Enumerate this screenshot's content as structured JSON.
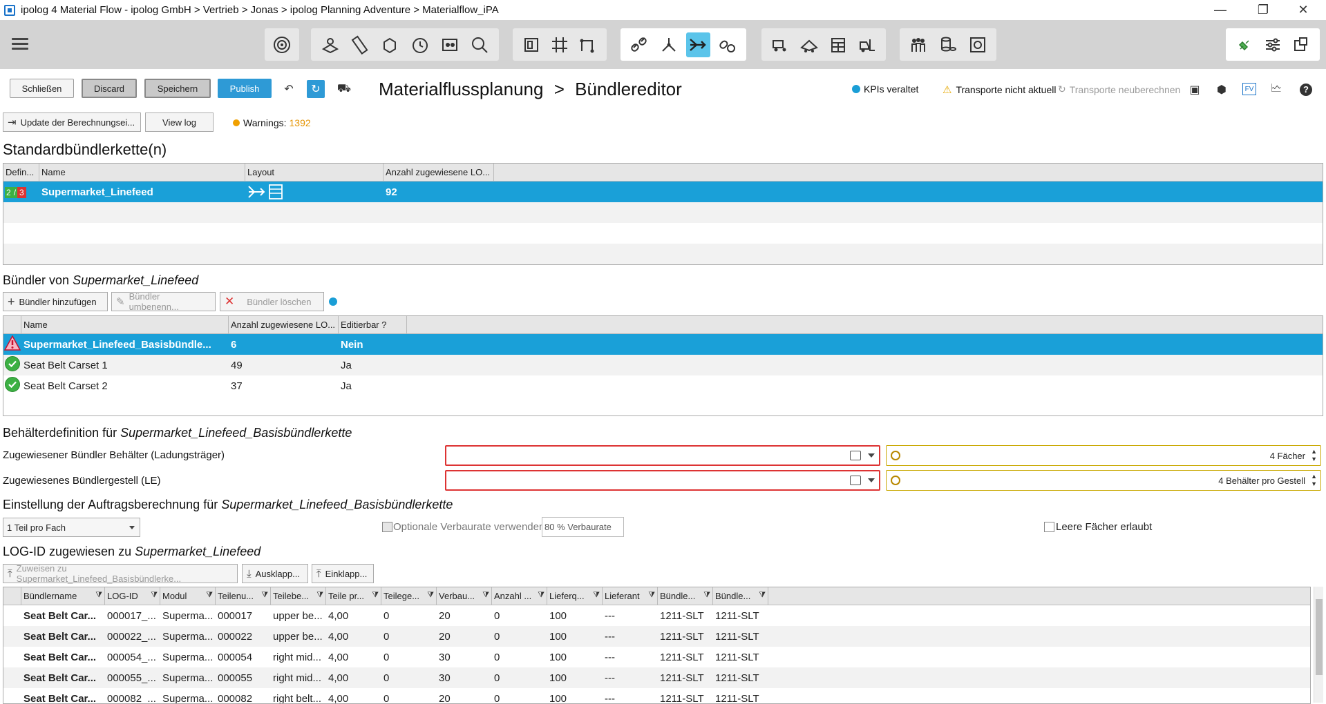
{
  "window": {
    "title": "ipolog 4 Material Flow - ipolog GmbH > Vertrieb > Jonas > ipolog Planning Adventure > Materialflow_iPA",
    "controls": [
      "minimize",
      "restore",
      "close"
    ]
  },
  "actions": {
    "close_label": "Schließen",
    "discard_label": "Discard",
    "save_label": "Speichern",
    "publish_label": "Publish"
  },
  "breadcrumb": {
    "part1": "Materialflussplanung",
    "separator": ">",
    "part2": "Bündlereditor"
  },
  "status": {
    "kpi_label": "KPIs veraltet",
    "transport_label": "Transporte nicht aktuell",
    "recalc_label": "Transporte neuberechnen"
  },
  "secondary": {
    "update_label": "Update der Berechnungsei...",
    "viewlog_label": "View log",
    "warnings_label": "Warnings:",
    "warnings_count": "1392"
  },
  "chains": {
    "title": "Standardbündlerkette(n)",
    "headers": [
      "Defin...",
      "Name",
      "Layout",
      "Anzahl zugewiesene LO..."
    ],
    "rows": [
      {
        "def_green": "2",
        "def_sep": "/",
        "def_red": "3",
        "name": "Supermarket_Linefeed",
        "count": "92"
      }
    ]
  },
  "bundlers": {
    "title_prefix": "Bündler von",
    "title_name": "Supermarket_Linefeed",
    "add_label": "Bündler hinzufügen",
    "rename_label": "Bündler umbenenn...",
    "delete_label": "Bündler löschen",
    "headers": [
      "Name",
      "Anzahl zugewiesene LO...",
      "Editierbar ?"
    ],
    "rows": [
      {
        "name": "Supermarket_Linefeed_Basisbündle...",
        "count": "6",
        "editable": "Nein"
      },
      {
        "name": "Seat Belt Carset 1",
        "count": "49",
        "editable": "Ja"
      },
      {
        "name": "Seat Belt Carset 2",
        "count": "37",
        "editable": "Ja"
      }
    ]
  },
  "container": {
    "title_prefix": "Behälterdefinition für",
    "title_name": "Supermarket_Linefeed_Basisbündlerkette",
    "field1_label": "Zugewiesener Bündler Behälter (Ladungsträger)",
    "field1_spin": "4 Fächer",
    "field2_label": "Zugewiesenes Bündlergestell (LE)",
    "field2_spin": "4 Behälter pro Gestell"
  },
  "order": {
    "title_prefix": "Einstellung der Auftragsberechnung für",
    "title_name": "Supermarket_Linefeed_Basisbündlerkette",
    "select_value": "1 Teil pro Fach",
    "optional_label": "Optionale Verbaurate verwenden",
    "rate_value": "80 % Verbaurate",
    "empty_label": "Leere Fächer erlaubt"
  },
  "logid": {
    "title_prefix": "LOG-ID zugewiesen zu",
    "title_name": "Supermarket_Linefeed",
    "assign_label": "Zuweisen zu Supermarket_Linefeed_Basisbündlerke...",
    "expand_label": "Ausklapp...",
    "collapse_label": "Einklapp...",
    "headers": [
      "Bündlername",
      "LOG-ID",
      "Modul",
      "Teilenu...",
      "Teilebe...",
      "Teile pr...",
      "Teilege...",
      "Verbau...",
      "Anzahl ...",
      "Lieferq...",
      "Lieferant",
      "Bündle...",
      "Bündle..."
    ],
    "rows": [
      [
        "Seat Belt Car...",
        "000017_...",
        "Superma...",
        "000017",
        "upper be...",
        "4,00",
        "0",
        "20",
        "0",
        "100",
        "---",
        "1211-SLT",
        "1211-SLT"
      ],
      [
        "Seat Belt Car...",
        "000022_...",
        "Superma...",
        "000022",
        "upper be...",
        "4,00",
        "0",
        "20",
        "0",
        "100",
        "---",
        "1211-SLT",
        "1211-SLT"
      ],
      [
        "Seat Belt Car...",
        "000054_...",
        "Superma...",
        "000054",
        "right mid...",
        "4,00",
        "0",
        "30",
        "0",
        "100",
        "---",
        "1211-SLT",
        "1211-SLT"
      ],
      [
        "Seat Belt Car...",
        "000055_...",
        "Superma...",
        "000055",
        "right mid...",
        "4,00",
        "0",
        "30",
        "0",
        "100",
        "---",
        "1211-SLT",
        "1211-SLT"
      ],
      [
        "Seat Belt Car...",
        "000082_...",
        "Superma...",
        "000082",
        "right belt...",
        "4,00",
        "0",
        "20",
        "0",
        "100",
        "---",
        "1211-SLT",
        "1211-SLT"
      ]
    ]
  },
  "colors": {
    "accent": "#1aa0d8",
    "toolbar_bg": "#d3d3d3",
    "warning": "#f0a000",
    "error": "#d33333",
    "ok": "#3cb043"
  }
}
